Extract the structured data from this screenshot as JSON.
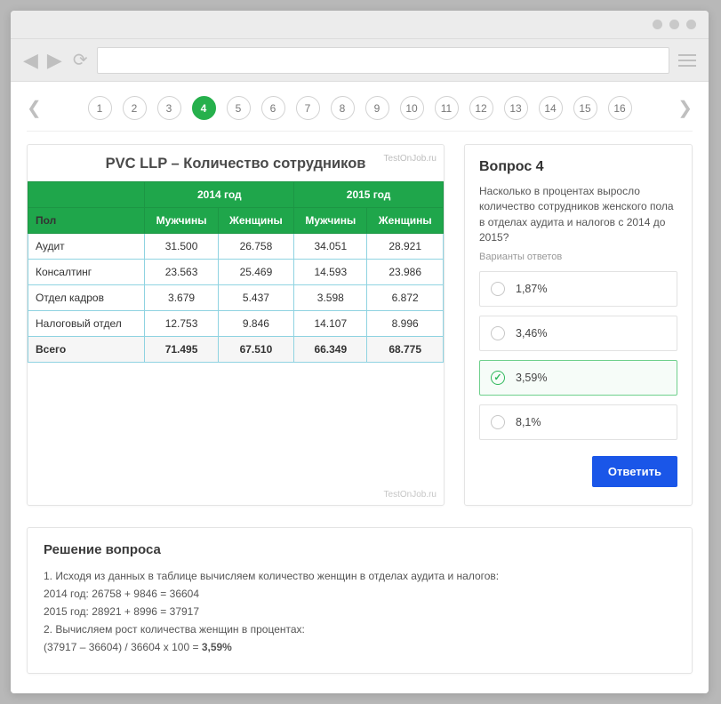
{
  "pagination": {
    "items": [
      "1",
      "2",
      "3",
      "4",
      "5",
      "6",
      "7",
      "8",
      "9",
      "10",
      "11",
      "12",
      "13",
      "14",
      "15",
      "16"
    ],
    "active_index": 3
  },
  "table": {
    "title": "PVC LLP – Количество сотрудников",
    "watermark_top": "TestOnJob.ru",
    "watermark_bottom": "TestOnJob.ru",
    "year_a": "2014 год",
    "year_b": "2015 год",
    "col_gender_label": "Пол",
    "col_men": "Мужчины",
    "col_women": "Женщины",
    "rows": [
      {
        "label": "Аудит",
        "m14": "31.500",
        "w14": "26.758",
        "m15": "34.051",
        "w15": "28.921"
      },
      {
        "label": "Консалтинг",
        "m14": "23.563",
        "w14": "25.469",
        "m15": "14.593",
        "w15": "23.986"
      },
      {
        "label": "Отдел кадров",
        "m14": "3.679",
        "w14": "5.437",
        "m15": "3.598",
        "w15": "6.872"
      },
      {
        "label": "Налоговый отдел",
        "m14": "12.753",
        "w14": "9.846",
        "m15": "14.107",
        "w15": "8.996"
      }
    ],
    "total": {
      "label": "Всего",
      "m14": "71.495",
      "w14": "67.510",
      "m15": "66.349",
      "w15": "68.775"
    }
  },
  "question": {
    "heading": "Вопрос 4",
    "text": "Насколько в процентах выросло количество сотрудников женского пола в отделах аудита и налогов с 2014 до 2015?",
    "options_label": "Варианты ответов",
    "options": [
      "1,87%",
      "3,46%",
      "3,59%",
      "8,1%"
    ],
    "selected_index": 2,
    "submit_label": "Ответить"
  },
  "solution": {
    "heading": "Решение вопроса",
    "line1": "1. Исходя из данных в таблице вычисляем количество женщин в отделах аудита и налогов:",
    "line2": "2014 год: 26758 + 9846 = 36604",
    "line3": "2015 год: 28921 + 8996 = 37917",
    "line4": "2. Вычисляем рост количества женщин в процентах:",
    "line5_a": "(37917 – 36604) / 36604 x 100 = ",
    "line5_b": "3,59%"
  }
}
